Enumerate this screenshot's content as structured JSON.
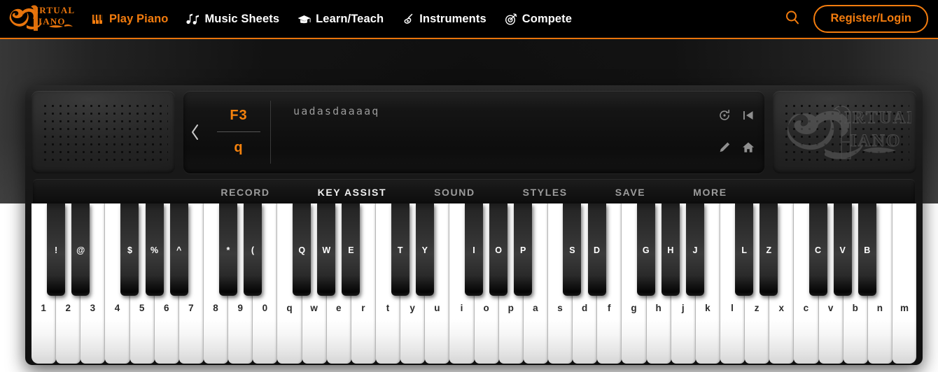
{
  "nav": {
    "brand": {
      "line1": "IRTUAL",
      "line2": "IANO",
      "name": "virtual-piano-logo"
    },
    "items": [
      {
        "label": "Play Piano",
        "icon": "piano-keys-icon",
        "active": true
      },
      {
        "label": "Music Sheets",
        "icon": "music-note-icon",
        "active": false
      },
      {
        "label": "Learn/Teach",
        "icon": "graduation-cap-icon",
        "active": false
      },
      {
        "label": "Instruments",
        "icon": "guitar-icon",
        "active": false
      },
      {
        "label": "Compete",
        "icon": "target-icon",
        "active": false
      }
    ],
    "search_icon": "search-icon",
    "register_login": "Register/Login"
  },
  "display": {
    "prev_arrow": "‹",
    "note_top": "F3",
    "note_bottom": "q",
    "sequence_text": "uadasdaaaaq",
    "tools": [
      {
        "name": "replay-icon",
        "label": "replay"
      },
      {
        "name": "rewind-to-start-icon",
        "label": "rewind"
      },
      {
        "name": "edit-pencil-icon",
        "label": "edit"
      },
      {
        "name": "home-icon",
        "label": "home"
      }
    ]
  },
  "watermark": {
    "line1": "IRTUAL",
    "line2": "IANO"
  },
  "menu": {
    "items": [
      {
        "label": "RECORD",
        "active": false
      },
      {
        "label": "KEY ASSIST",
        "active": true
      },
      {
        "label": "SOUND",
        "active": false
      },
      {
        "label": "STYLES",
        "active": false
      },
      {
        "label": "SAVE",
        "active": false
      },
      {
        "label": "MORE",
        "active": false
      }
    ]
  },
  "keyboard": {
    "white_keys": [
      "1",
      "2",
      "3",
      "4",
      "5",
      "6",
      "7",
      "8",
      "9",
      "0",
      "q",
      "w",
      "e",
      "r",
      "t",
      "y",
      "u",
      "i",
      "o",
      "p",
      "a",
      "s",
      "d",
      "f",
      "g",
      "h",
      "j",
      "k",
      "l",
      "z",
      "x",
      "c",
      "v",
      "b",
      "n",
      "m"
    ],
    "black_keys": [
      {
        "label": "!",
        "after": 0
      },
      {
        "label": "@",
        "after": 1
      },
      {
        "label": "$",
        "after": 3
      },
      {
        "label": "%",
        "after": 4
      },
      {
        "label": "^",
        "after": 5
      },
      {
        "label": "*",
        "after": 7
      },
      {
        "label": "(",
        "after": 8
      },
      {
        "label": "Q",
        "after": 10
      },
      {
        "label": "W",
        "after": 11
      },
      {
        "label": "E",
        "after": 12
      },
      {
        "label": "T",
        "after": 14
      },
      {
        "label": "Y",
        "after": 15
      },
      {
        "label": "I",
        "after": 17
      },
      {
        "label": "O",
        "after": 18
      },
      {
        "label": "P",
        "after": 19
      },
      {
        "label": "S",
        "after": 21
      },
      {
        "label": "D",
        "after": 22
      },
      {
        "label": "G",
        "after": 24
      },
      {
        "label": "H",
        "after": 25
      },
      {
        "label": "J",
        "after": 26
      },
      {
        "label": "L",
        "after": 28
      },
      {
        "label": "Z",
        "after": 29
      },
      {
        "label": "C",
        "after": 31
      },
      {
        "label": "V",
        "after": 32
      },
      {
        "label": "B",
        "after": 33
      }
    ]
  },
  "colors": {
    "accent": "#f37c0e",
    "nav_bg": "#000000",
    "piano_body": "#1a1a1a",
    "note_text": "#f5820d",
    "sequence_text": "#9a9a9a"
  }
}
